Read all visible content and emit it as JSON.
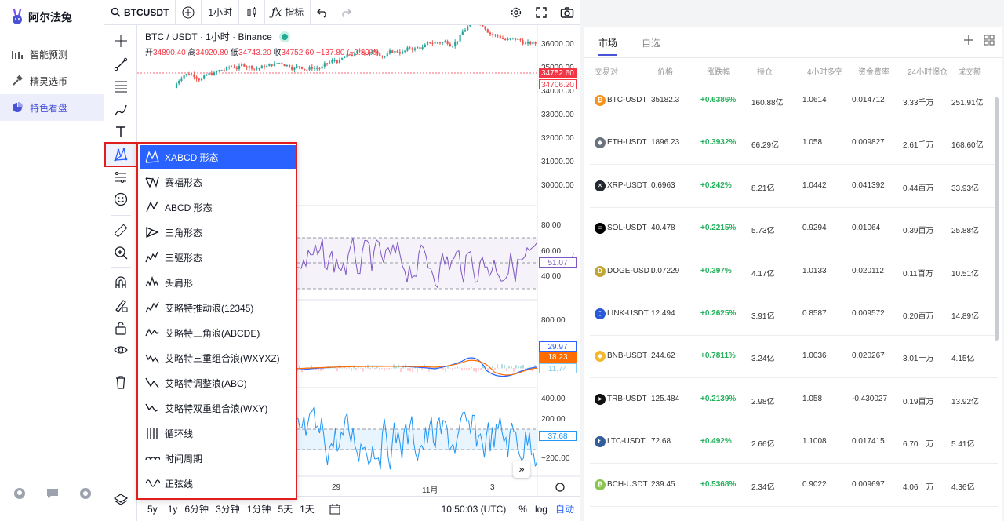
{
  "app": {
    "name": "阿尔法兔"
  },
  "nav": [
    {
      "label": "智能预测",
      "icon": "chart-icon"
    },
    {
      "label": "精灵选币",
      "icon": "hammer-icon"
    },
    {
      "label": "特色看盘",
      "icon": "pie-chart-icon",
      "active": true
    }
  ],
  "toolbar": {
    "symbol": "BTCUSDT",
    "interval": "1小时",
    "indicators": "指标"
  },
  "chart": {
    "title": "BTC / USDT · 1小时 · Binance",
    "open_label": "开",
    "open": "34890.40",
    "high_label": "高",
    "high": "34920.80",
    "low_label": "低",
    "low": "34743.20",
    "close_label": "收",
    "close": "34752.60",
    "change": "−137.80 (−0.39%)",
    "last_price": "34752.60",
    "second_price": "34706.20",
    "price_axis": [
      "36000.00",
      "35000.00",
      "34000.00",
      "33000.00",
      "32000.00",
      "31000.00",
      "30000.00"
    ],
    "rsi_axis": [
      "80.00",
      "60.00",
      "40.00"
    ],
    "rsi_value": "51.07",
    "macd_axis": [
      "800.00"
    ],
    "macd_values": [
      "29.97",
      "18.23",
      "11.74"
    ],
    "cci_axis": [
      "400.00",
      "200.00",
      "−200.00"
    ],
    "cci_value": "37.68",
    "time_axis": [
      "29",
      "11月",
      "3"
    ],
    "ranges": [
      "5y",
      "1y",
      "6分钟",
      "3分钟",
      "1分钟",
      "5天",
      "1天"
    ],
    "clock": "10:50:03 (UTC)",
    "percent": "%",
    "log": "log",
    "auto": "自动",
    "scroll_right": "»"
  },
  "patterns": [
    {
      "label": "XABCD 形态",
      "icon": "xabcd-pattern-icon",
      "selected": true
    },
    {
      "label": "赛福形态",
      "icon": "cypher-pattern-icon"
    },
    {
      "label": "ABCD 形态",
      "icon": "abcd-pattern-icon"
    },
    {
      "label": "三角形态",
      "icon": "triangle-pattern-icon"
    },
    {
      "label": "三驱形态",
      "icon": "three-drives-pattern-icon"
    },
    {
      "label": "头肩形",
      "icon": "head-shoulders-icon"
    },
    {
      "label": "艾略特推动浪(12345)",
      "icon": "elliott-impulse-icon"
    },
    {
      "label": "艾略特三角浪(ABCDE)",
      "icon": "elliott-triangle-icon"
    },
    {
      "label": "艾略特三重组合浪(WXYXZ)",
      "icon": "elliott-triple-combo-icon"
    },
    {
      "label": "艾略特调整浪(ABC)",
      "icon": "elliott-correction-icon"
    },
    {
      "label": "艾略特双重组合浪(WXY)",
      "icon": "elliott-double-combo-icon"
    },
    {
      "label": "循环线",
      "icon": "cyclic-lines-icon"
    },
    {
      "label": "时间周期",
      "icon": "time-cycles-icon"
    },
    {
      "label": "正弦线",
      "icon": "sine-line-icon"
    }
  ],
  "market": {
    "tabs": [
      "市场",
      "自选"
    ],
    "columns": [
      "交易对",
      "价格",
      "涨跌幅",
      "持仓",
      "4小时多空",
      "资金费率",
      "24小时爆仓",
      "成交额"
    ],
    "rows": [
      {
        "pair": "BTC-USDT",
        "price": "35182.3",
        "change": "+0.6386%",
        "oi": "160.88亿",
        "ls": "1.0614",
        "funding": "0.014712",
        "liq": "3.33千万",
        "vol": "251.91亿",
        "color": "#f7931a",
        "glyph": "₿"
      },
      {
        "pair": "ETH-USDT",
        "price": "1896.23",
        "change": "+0.3932%",
        "oi": "66.29亿",
        "ls": "1.058",
        "funding": "0.009827",
        "liq": "2.61千万",
        "vol": "168.60亿",
        "color": "#6b7280",
        "glyph": "◆"
      },
      {
        "pair": "XRP-USDT",
        "price": "0.6963",
        "change": "+0.242%",
        "oi": "8.21亿",
        "ls": "1.0442",
        "funding": "0.041392",
        "liq": "0.44百万",
        "vol": "33.93亿",
        "color": "#23292f",
        "glyph": "✕"
      },
      {
        "pair": "SOL-USDT",
        "price": "40.478",
        "change": "+0.2215%",
        "oi": "5.73亿",
        "ls": "0.9294",
        "funding": "0.01064",
        "liq": "0.39百万",
        "vol": "25.88亿",
        "color": "#000000",
        "glyph": "≡"
      },
      {
        "pair": "DOGE-USDT",
        "price": "0.07229",
        "change": "+0.397%",
        "oi": "4.17亿",
        "ls": "1.0133",
        "funding": "0.020112",
        "liq": "0.11百万",
        "vol": "10.51亿",
        "color": "#c2a633",
        "glyph": "D"
      },
      {
        "pair": "LINK-USDT",
        "price": "12.494",
        "change": "+0.2625%",
        "oi": "3.91亿",
        "ls": "0.8587",
        "funding": "0.009572",
        "liq": "0.20百万",
        "vol": "14.89亿",
        "color": "#2a5ada",
        "glyph": "⬡"
      },
      {
        "pair": "BNB-USDT",
        "price": "244.62",
        "change": "+0.7811%",
        "oi": "3.24亿",
        "ls": "1.0036",
        "funding": "0.020267",
        "liq": "3.01十万",
        "vol": "4.15亿",
        "color": "#f3ba2f",
        "glyph": "◆"
      },
      {
        "pair": "TRB-USDT",
        "price": "125.484",
        "change": "+0.2139%",
        "oi": "2.98亿",
        "ls": "1.058",
        "funding": "-0.430027",
        "liq": "0.19百万",
        "vol": "13.92亿",
        "color": "#111111",
        "glyph": "➤"
      },
      {
        "pair": "LTC-USDT",
        "price": "72.68",
        "change": "+0.492%",
        "oi": "2.66亿",
        "ls": "1.1008",
        "funding": "0.017415",
        "liq": "6.70十万",
        "vol": "5.41亿",
        "color": "#345d9d",
        "glyph": "Ł"
      },
      {
        "pair": "BCH-USDT",
        "price": "239.45",
        "change": "+0.5368%",
        "oi": "2.34亿",
        "ls": "0.9022",
        "funding": "0.009697",
        "liq": "4.06十万",
        "vol": "4.36亿",
        "color": "#8dc351",
        "glyph": "₿"
      }
    ]
  },
  "colors": {
    "accent": "#4a52d6",
    "up": "#22b05a",
    "down": "#f23645",
    "selection": "#2962ff",
    "highlight_border": "#e11d1d"
  }
}
